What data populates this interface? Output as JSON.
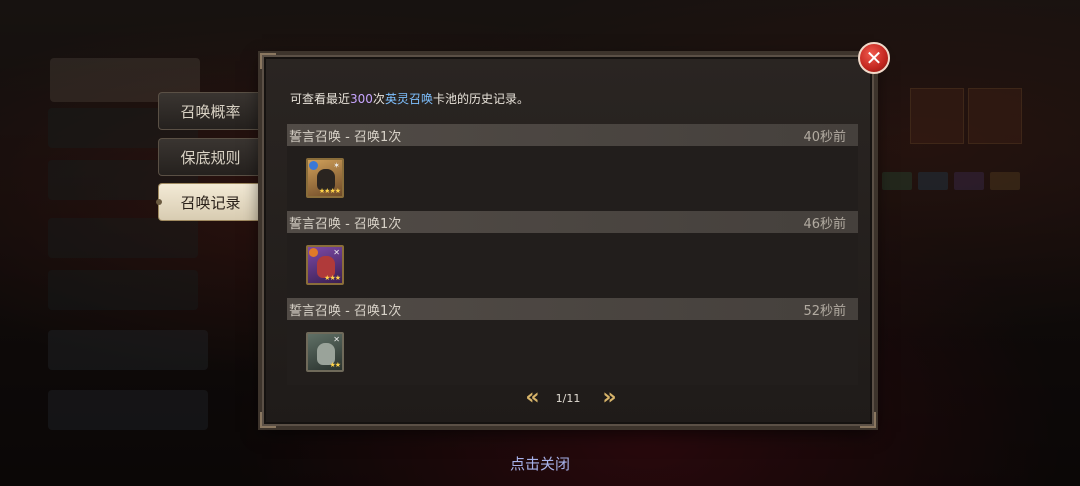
{
  "side_tabs": [
    {
      "label": "召唤概率",
      "active": false
    },
    {
      "label": "保底规则",
      "active": false
    },
    {
      "label": "召唤记录",
      "active": true
    }
  ],
  "info": {
    "prefix": "可查看最近",
    "count": "300",
    "mid": "次",
    "pool_name": "英灵召唤",
    "suffix": "卡池的历史记录。"
  },
  "records": [
    {
      "title": "誓言召唤 - 召唤1次",
      "time": "40秒前",
      "hero_stars": "★★★★",
      "hero_color": "#b88a4a",
      "elem_color": "#3a78d8",
      "class_icon": "✶"
    },
    {
      "title": "誓言召唤 - 召唤1次",
      "time": "46秒前",
      "hero_stars": "★★★",
      "hero_color": "#6a3a8a",
      "elem_color": "#e07a28",
      "class_icon": "✕"
    },
    {
      "title": "誓言召唤 - 召唤1次",
      "time": "52秒前",
      "hero_stars": "★★",
      "hero_color": "#4d5c52",
      "elem_color": "",
      "class_icon": "✕"
    }
  ],
  "pager": {
    "prev_icon": "«",
    "page": "1/11",
    "next_icon": "»"
  },
  "close_icon": "✕",
  "tap_to_close": "点击关闭"
}
